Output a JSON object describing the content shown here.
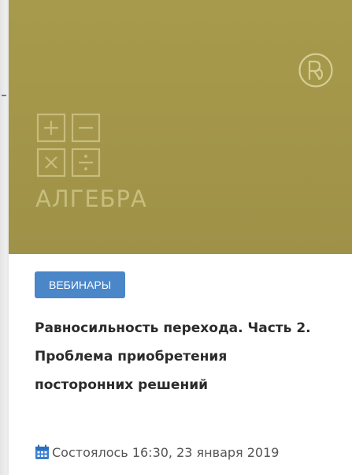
{
  "cover": {
    "logo_icon": "r-monogram-logo",
    "math_icon": "plus-minus-multiply-divide-icon",
    "subject": "АЛГЕБРА",
    "background_color": "#a79a4c",
    "accent_color": "#c7bd7d"
  },
  "badge": {
    "label": "ВЕБИНАРЫ",
    "color": "#4a86c8"
  },
  "title_lines": [
    "Равносильность перехода. Часть 2.",
    "Проблема приобретения",
    "посторонних решений"
  ],
  "meta": {
    "icon": "calendar-icon",
    "text": "Состоялось 16:30, 23 января 2019"
  }
}
